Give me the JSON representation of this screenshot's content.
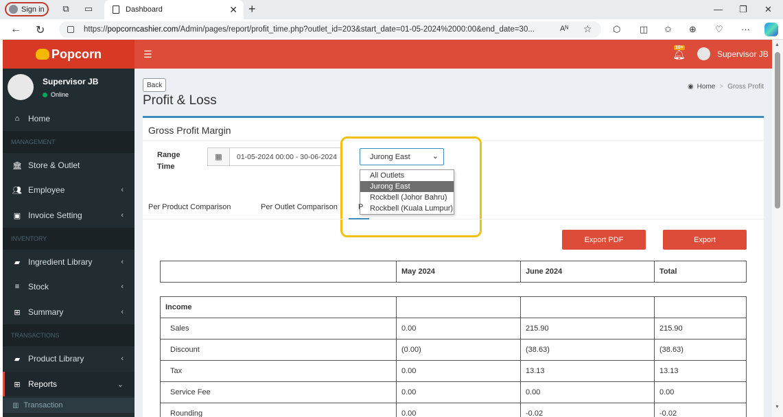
{
  "browser": {
    "signin_label": "Sign in",
    "tab_title": "Dashboard",
    "url_prefix": "https://",
    "url_host": "popcorncashier.com",
    "url_rest": "/Admin/pages/report/profit_time.php?outlet_id=203&start_date=01-05-2024%2000:00&end_date=30...",
    "reader_label": "Aᴺ"
  },
  "header": {
    "brand": "Popcorn",
    "notification_badge": "10+",
    "user_name": "Supervisor JB"
  },
  "sidebar": {
    "user_name": "Supervisor JB",
    "user_status": "Online",
    "home": "Home",
    "section_management": "MANAGEMENT",
    "store_outlet": "Store & Outlet",
    "employee": "Employee",
    "invoice_setting": "Invoice Setting",
    "section_inventory": "INVENTORY",
    "ingredient_library": "Ingredient Library",
    "stock": "Stock",
    "summary": "Summary",
    "section_transactions": "TRANSACTIONS",
    "product_library": "Product Library",
    "reports": "Reports",
    "transaction": "Transaction"
  },
  "content": {
    "back_label": "Back",
    "page_title": "Profit & Loss",
    "breadcrumb_home": "Home",
    "breadcrumb_current": "Gross Profit",
    "box_title": "Gross Profit Margin",
    "range_label_line1": "Range",
    "range_label_line2": "Time",
    "date_range": "01-05-2024 00:00 - 30-06-2024",
    "outlet_selected": "Jurong East",
    "outlet_options": [
      "All Outlets",
      "Jurong East",
      "Rockbell (Johor Bahru)",
      "Rockbell (Kuala Lumpur)"
    ],
    "tabs": [
      "Per Product Comparison",
      "Per Outlet Comparison",
      "P"
    ],
    "export_pdf_label": "Export PDF",
    "export_label": "Export"
  },
  "table": {
    "headers": [
      "",
      "May 2024",
      "June 2024",
      "Total"
    ],
    "section_income": "Income",
    "rows": [
      {
        "label": "Sales",
        "may": "0.00",
        "june": "215.90",
        "total": "215.90"
      },
      {
        "label": "Discount",
        "may": "(0.00)",
        "june": "(38.63)",
        "total": "(38.63)"
      },
      {
        "label": "Tax",
        "may": "0.00",
        "june": "13.13",
        "total": "13.13"
      },
      {
        "label": "Service Fee",
        "may": "0.00",
        "june": "0.00",
        "total": "0.00"
      },
      {
        "label": "Rounding",
        "may": "0.00",
        "june": "-0.02",
        "total": "-0.02"
      }
    ]
  },
  "colors": {
    "header_red": "#dd4b39",
    "sidebar_dark": "#222d32",
    "accent_blue": "#3c8dbc",
    "highlight_yellow": "#f2c010"
  }
}
